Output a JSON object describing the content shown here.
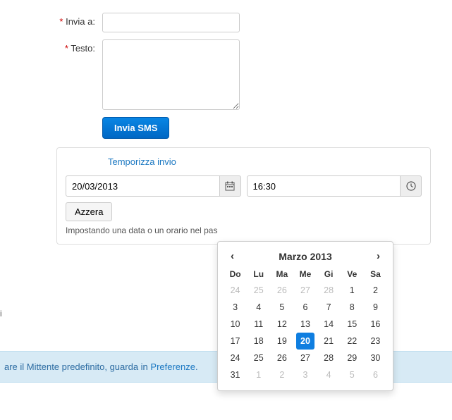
{
  "form": {
    "invia_a_label": "Invia a:",
    "testo_label": "Testo:",
    "submit_label": "Invia SMS"
  },
  "schedule": {
    "title": "Temporizza invio",
    "date_value": "20/03/2013",
    "time_value": "16:30",
    "reset_label": "Azzera",
    "help": "Impostando una data o un orario nel pas"
  },
  "footer": {
    "text_prefix": "are il Mittente predefinito, guarda in ",
    "link": "Preferenze",
    "text_suffix": "."
  },
  "side": {
    "truncated": "i"
  },
  "datepicker": {
    "month_title": "Marzo 2013",
    "dow": [
      "Do",
      "Lu",
      "Ma",
      "Me",
      "Gi",
      "Ve",
      "Sa"
    ],
    "weeks": [
      [
        {
          "d": 24,
          "o": true
        },
        {
          "d": 25,
          "o": true
        },
        {
          "d": 26,
          "o": true
        },
        {
          "d": 27,
          "o": true
        },
        {
          "d": 28,
          "o": true
        },
        {
          "d": 1
        },
        {
          "d": 2
        }
      ],
      [
        {
          "d": 3
        },
        {
          "d": 4
        },
        {
          "d": 5
        },
        {
          "d": 6
        },
        {
          "d": 7
        },
        {
          "d": 8
        },
        {
          "d": 9
        }
      ],
      [
        {
          "d": 10
        },
        {
          "d": 11
        },
        {
          "d": 12
        },
        {
          "d": 13
        },
        {
          "d": 14
        },
        {
          "d": 15
        },
        {
          "d": 16
        }
      ],
      [
        {
          "d": 17
        },
        {
          "d": 18
        },
        {
          "d": 19
        },
        {
          "d": 20,
          "sel": true
        },
        {
          "d": 21
        },
        {
          "d": 22
        },
        {
          "d": 23
        }
      ],
      [
        {
          "d": 24
        },
        {
          "d": 25
        },
        {
          "d": 26
        },
        {
          "d": 27
        },
        {
          "d": 28
        },
        {
          "d": 29
        },
        {
          "d": 30
        }
      ],
      [
        {
          "d": 31
        },
        {
          "d": 1,
          "o": true
        },
        {
          "d": 2,
          "o": true
        },
        {
          "d": 3,
          "o": true
        },
        {
          "d": 4,
          "o": true
        },
        {
          "d": 5,
          "o": true
        },
        {
          "d": 6,
          "o": true
        }
      ]
    ]
  }
}
